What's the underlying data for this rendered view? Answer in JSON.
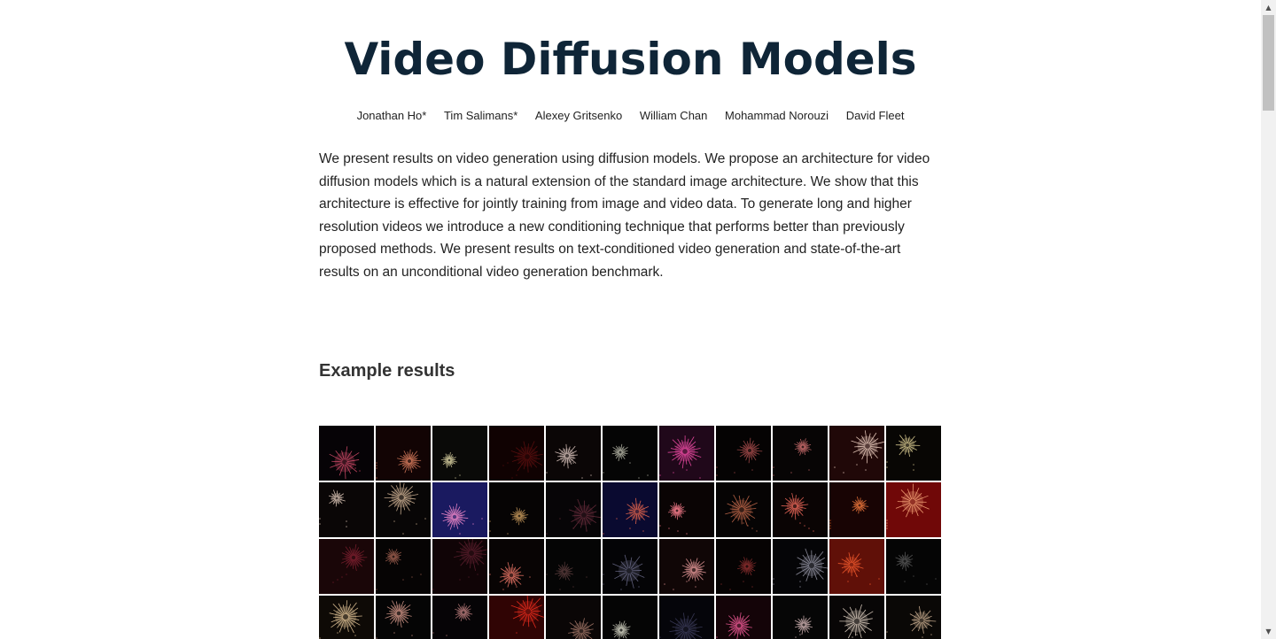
{
  "title": "Video Diffusion Models",
  "authors": [
    "Jonathan Ho*",
    "Tim Salimans*",
    "Alexey Gritsenko",
    "William Chan",
    "Mohammad Norouzi",
    "David Fleet"
  ],
  "abstract": "We present results on video generation using diffusion models. We propose an architecture for video diffusion models which is a natural extension of the standard image architecture. We show that this architecture is effective for jointly training from image and video data. To generate long and higher resolution videos we introduce a new conditioning technique that performs better than previously proposed methods. We present results on text-conditioned video generation and state-of-the-art results on an unconditional video generation benchmark.",
  "section_heading": "Example results",
  "gallery": {
    "columns": 11,
    "rows": 4,
    "tiles": [
      {
        "bg": "#060306",
        "burst": "#e05070"
      },
      {
        "bg": "#120404",
        "burst": "#e08060"
      },
      {
        "bg": "#0a0a08",
        "burst": "#d8d0a0"
      },
      {
        "bg": "#100202",
        "burst": "#601010"
      },
      {
        "bg": "#0b0606",
        "burst": "#f0d8d0"
      },
      {
        "bg": "#050505",
        "burst": "#c0c0b0"
      },
      {
        "bg": "#20081a",
        "burst": "#ff50b0"
      },
      {
        "bg": "#050303",
        "burst": "#b05050"
      },
      {
        "bg": "#070505",
        "burst": "#d07070"
      },
      {
        "bg": "#200808",
        "burst": "#ffe0d0"
      },
      {
        "bg": "#080604",
        "burst": "#f0e0a0"
      },
      {
        "bg": "#0a0606",
        "burst": "#f0d8c8"
      },
      {
        "bg": "#080606",
        "burst": "#e0c0a0"
      },
      {
        "bg": "#1a1a60",
        "burst": "#ff90d0"
      },
      {
        "bg": "#060404",
        "burst": "#d0a060"
      },
      {
        "bg": "#070507",
        "burst": "#703040"
      },
      {
        "bg": "#0a0a30",
        "burst": "#ff7050"
      },
      {
        "bg": "#0a0404",
        "burst": "#ff8090"
      },
      {
        "bg": "#060404",
        "burst": "#d07050"
      },
      {
        "bg": "#0a0404",
        "burst": "#ff7060"
      },
      {
        "bg": "#180404",
        "burst": "#ff8040"
      },
      {
        "bg": "#700808",
        "burst": "#ffb080"
      },
      {
        "bg": "#1a0608",
        "burst": "#802030"
      },
      {
        "bg": "#060404",
        "burst": "#a06050"
      },
      {
        "bg": "#100406",
        "burst": "#602030"
      },
      {
        "bg": "#080404",
        "burst": "#ff8070"
      },
      {
        "bg": "#050505",
        "burst": "#604040"
      },
      {
        "bg": "#040406",
        "burst": "#707090"
      },
      {
        "bg": "#100606",
        "burst": "#f0a0a0"
      },
      {
        "bg": "#060303",
        "burst": "#903030"
      },
      {
        "bg": "#050507",
        "burst": "#a0a0b0"
      },
      {
        "bg": "#601008",
        "burst": "#ff6030"
      },
      {
        "bg": "#050505",
        "burst": "#606060"
      },
      {
        "bg": "#0e0a06",
        "burst": "#f0d0a0"
      },
      {
        "bg": "#050505",
        "burst": "#e0a090"
      },
      {
        "bg": "#060406",
        "burst": "#c08080"
      },
      {
        "bg": "#300404",
        "burst": "#ff3020"
      },
      {
        "bg": "#0a0606",
        "burst": "#b08070"
      },
      {
        "bg": "#050505",
        "burst": "#d0d0c0"
      },
      {
        "bg": "#05050a",
        "burst": "#404060"
      },
      {
        "bg": "#140408",
        "burst": "#ff60a0"
      },
      {
        "bg": "#060606",
        "burst": "#e0c0c0"
      },
      {
        "bg": "#080606",
        "burst": "#f0e0d0"
      },
      {
        "bg": "#0a0806",
        "burst": "#e0c0a0"
      }
    ]
  },
  "scrollbar": {
    "up_icon": "▲",
    "down_icon": "▼"
  }
}
